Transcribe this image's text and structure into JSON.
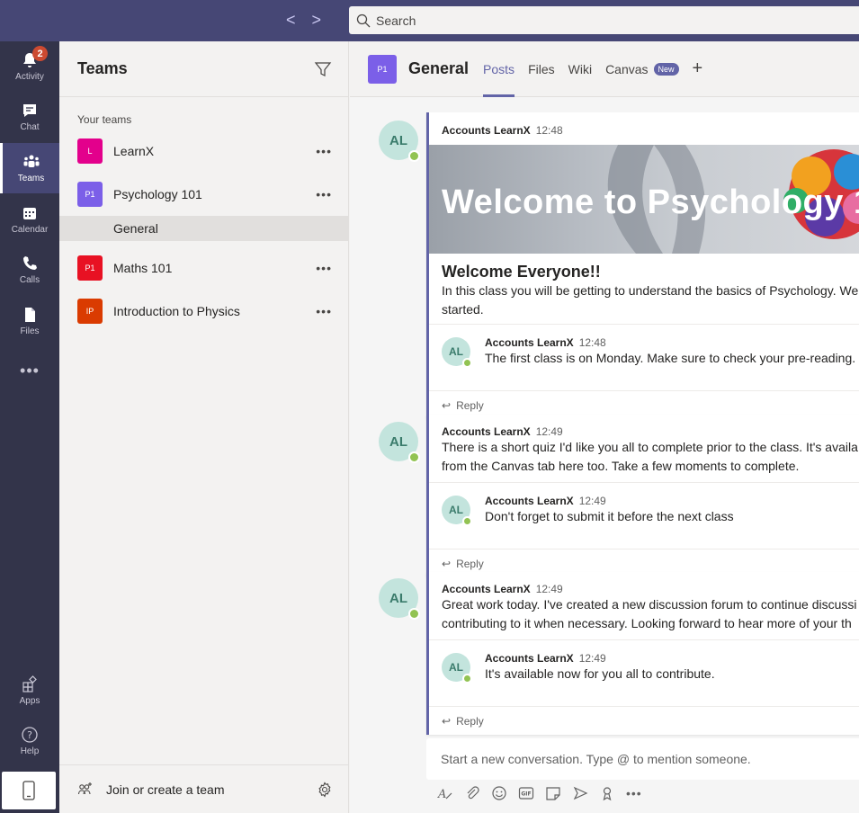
{
  "topbar": {
    "back_arrow": "<",
    "forward_arrow": ">",
    "search_placeholder": "Search"
  },
  "rail": {
    "activity": {
      "label": "Activity",
      "badge": "2"
    },
    "chat": {
      "label": "Chat"
    },
    "teams": {
      "label": "Teams"
    },
    "calendar": {
      "label": "Calendar"
    },
    "calls": {
      "label": "Calls"
    },
    "files": {
      "label": "Files"
    },
    "more": "•••",
    "apps": {
      "label": "Apps"
    },
    "help": {
      "label": "Help"
    }
  },
  "teams_panel": {
    "title": "Teams",
    "section_label": "Your teams",
    "teams": [
      {
        "initials": "L",
        "name": "LearnX",
        "color": "#e3008c"
      },
      {
        "initials": "P1",
        "name": "Psychology 101",
        "color": "#7b5fe8"
      },
      {
        "initials": "P1",
        "name": "Maths 101",
        "color": "#e81123"
      },
      {
        "initials": "IP",
        "name": "Introduction to Physics",
        "color": "#da3b01"
      }
    ],
    "selected_channel": "General",
    "more": "•••",
    "join_label": "Join or create a team"
  },
  "channel": {
    "initials": "P1",
    "name": "General",
    "tabs": [
      "Posts",
      "Files",
      "Wiki",
      "Canvas"
    ],
    "new_badge": "New",
    "add_tab": "+"
  },
  "posts": [
    {
      "avatar": "AL",
      "author": "Accounts LearnX",
      "time": "12:48",
      "banner_text": "Welcome to Psychology 1",
      "heading": "Welcome Everyone!!",
      "body": "In this class you will be getting to understand the basics of Psychology. We",
      "body2": "started.",
      "reply": {
        "avatar": "AL",
        "author": "Accounts LearnX",
        "time": "12:48",
        "body": "The first class is on Monday. Make sure to check your pre-reading."
      }
    },
    {
      "avatar": "AL",
      "author": "Accounts LearnX",
      "time": "12:49",
      "body": "There is a short quiz I'd like you all to complete prior to the class. It's availa",
      "body2": "from the Canvas tab here too. Take a few moments to complete.",
      "reply": {
        "avatar": "AL",
        "author": "Accounts LearnX",
        "time": "12:49",
        "body": "Don't forget to submit it before the next class"
      }
    },
    {
      "avatar": "AL",
      "author": "Accounts LearnX",
      "time": "12:49",
      "body": "Great work today. I've created a new discussion forum to continue discussi",
      "body2": "contributing to it when necessary. Looking forward to hear more of your th",
      "reply": {
        "avatar": "AL",
        "author": "Accounts LearnX",
        "time": "12:49",
        "body": "It's available now for you all to contribute."
      }
    }
  ],
  "reply_label": "Reply",
  "compose": {
    "placeholder": "Start a new conversation. Type @ to mention someone.",
    "more": "•••"
  }
}
